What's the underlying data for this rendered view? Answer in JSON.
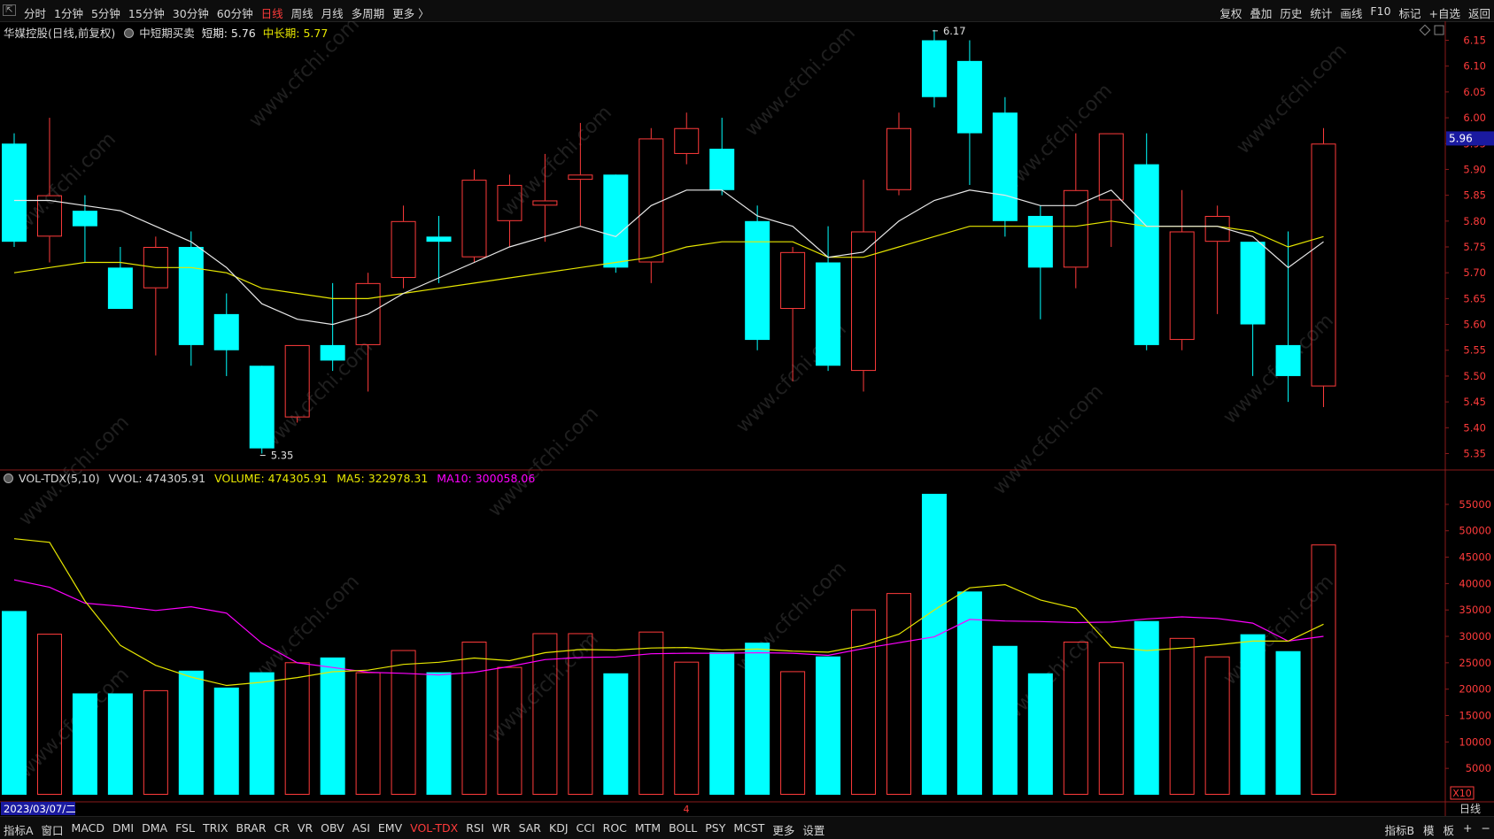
{
  "toolbar": {
    "left_items": [
      "分时",
      "1分钟",
      "5分钟",
      "15分钟",
      "30分钟",
      "60分钟",
      "日线",
      "周线",
      "月线",
      "多周期",
      "更多 〉"
    ],
    "active_item": "日线",
    "right_items": [
      "复权",
      "叠加",
      "历史",
      "统计",
      "画线",
      "F10",
      "标记",
      "+自选",
      "返回"
    ]
  },
  "main_info": {
    "stock": "华媒控股(日线,前复权)",
    "indicator": "中短期买卖",
    "short_label": "短期:",
    "short_value": "5.76",
    "mid_label": "中长期:",
    "mid_value": "5.77"
  },
  "vol_info": {
    "name": "VOL-TDX(5,10)",
    "vvol": "VVOL: 474305.91",
    "volume": "VOLUME: 474305.91",
    "ma5": "MA5: 322978.31",
    "ma10": "MA10: 300058.06"
  },
  "date_label": "2023/03/07/二",
  "x10_label": "X10",
  "period_label": "日线",
  "cursor_marker": "4",
  "bottom_tabs": [
    "指标A",
    "窗口",
    "MACD",
    "DMI",
    "DMA",
    "FSL",
    "TRIX",
    "BRAR",
    "CR",
    "VR",
    "OBV",
    "ASI",
    "EMV",
    "VOL-TDX",
    "RSI",
    "WR",
    "SAR",
    "KDJ",
    "CCI",
    "ROC",
    "MTM",
    "BOLL",
    "PSY",
    "MCST",
    "更多",
    "设置"
  ],
  "bottom_active": "VOL-TDX",
  "bottom_right": [
    "指标B",
    "模",
    "板",
    "+",
    "−"
  ],
  "watermark": "www.cfchi.com",
  "colors": {
    "up": "#ff3b3b",
    "down": "#00ffff",
    "ma_short": "#e8e8e8",
    "ma_long": "#e6e600",
    "vol_ma5": "#e6e600",
    "vol_ma10": "#ff00ff",
    "price_box": "#1a1aa0"
  },
  "chart_data": {
    "type": "candlestick",
    "price_axis": {
      "min": 5.32,
      "max": 6.18,
      "ticks": [
        "6.15",
        "6.10",
        "6.05",
        "6.00",
        "5.95",
        "5.90",
        "5.85",
        "5.80",
        "5.75",
        "5.70",
        "5.65",
        "5.60",
        "5.55",
        "5.50",
        "5.45",
        "5.40",
        "5.35"
      ]
    },
    "current_price": "5.96",
    "high_label": "6.17",
    "low_label": "5.35",
    "volume_axis": {
      "max": 58000,
      "ticks": [
        "55000",
        "50000",
        "45000",
        "40000",
        "35000",
        "30000",
        "25000",
        "20000",
        "15000",
        "10000",
        "5000"
      ]
    },
    "candles": [
      {
        "o": 5.95,
        "c": 5.76,
        "h": 5.97,
        "l": 5.75
      },
      {
        "o": 5.77,
        "c": 5.85,
        "h": 6.0,
        "l": 5.72
      },
      {
        "o": 5.82,
        "c": 5.79,
        "h": 5.85,
        "l": 5.72
      },
      {
        "o": 5.71,
        "c": 5.63,
        "h": 5.75,
        "l": 5.63
      },
      {
        "o": 5.67,
        "c": 5.75,
        "h": 5.77,
        "l": 5.54
      },
      {
        "o": 5.75,
        "c": 5.56,
        "h": 5.78,
        "l": 5.52
      },
      {
        "o": 5.62,
        "c": 5.55,
        "h": 5.66,
        "l": 5.5
      },
      {
        "o": 5.52,
        "c": 5.36,
        "h": 5.52,
        "l": 5.35
      },
      {
        "o": 5.42,
        "c": 5.56,
        "h": 5.56,
        "l": 5.41
      },
      {
        "o": 5.56,
        "c": 5.53,
        "h": 5.68,
        "l": 5.51
      },
      {
        "o": 5.56,
        "c": 5.68,
        "h": 5.7,
        "l": 5.47
      },
      {
        "o": 5.69,
        "c": 5.8,
        "h": 5.83,
        "l": 5.67
      },
      {
        "o": 5.77,
        "c": 5.76,
        "h": 5.81,
        "l": 5.68
      },
      {
        "o": 5.73,
        "c": 5.88,
        "h": 5.9,
        "l": 5.72
      },
      {
        "o": 5.8,
        "c": 5.87,
        "h": 5.89,
        "l": 5.75
      },
      {
        "o": 5.83,
        "c": 5.84,
        "h": 5.93,
        "l": 5.76
      },
      {
        "o": 5.88,
        "c": 5.89,
        "h": 5.99,
        "l": 5.79
      },
      {
        "o": 5.89,
        "c": 5.71,
        "h": 5.89,
        "l": 5.7
      },
      {
        "o": 5.72,
        "c": 5.96,
        "h": 5.98,
        "l": 5.68
      },
      {
        "o": 5.93,
        "c": 5.98,
        "h": 6.01,
        "l": 5.91
      },
      {
        "o": 5.94,
        "c": 5.86,
        "h": 6.0,
        "l": 5.85
      },
      {
        "o": 5.8,
        "c": 5.57,
        "h": 5.83,
        "l": 5.55
      },
      {
        "o": 5.63,
        "c": 5.74,
        "h": 5.75,
        "l": 5.49
      },
      {
        "o": 5.72,
        "c": 5.52,
        "h": 5.79,
        "l": 5.51
      },
      {
        "o": 5.51,
        "c": 5.78,
        "h": 5.88,
        "l": 5.47
      },
      {
        "o": 5.86,
        "c": 5.98,
        "h": 6.01,
        "l": 5.85
      },
      {
        "o": 6.15,
        "c": 6.04,
        "h": 6.17,
        "l": 6.02
      },
      {
        "o": 6.11,
        "c": 5.97,
        "h": 6.15,
        "l": 5.87
      },
      {
        "o": 6.01,
        "c": 5.8,
        "h": 6.04,
        "l": 5.77
      },
      {
        "o": 5.81,
        "c": 5.71,
        "h": 5.83,
        "l": 5.61
      },
      {
        "o": 5.71,
        "c": 5.86,
        "h": 5.97,
        "l": 5.67
      },
      {
        "o": 5.84,
        "c": 5.97,
        "h": 5.97,
        "l": 5.75
      },
      {
        "o": 5.91,
        "c": 5.56,
        "h": 5.97,
        "l": 5.55
      },
      {
        "o": 5.57,
        "c": 5.78,
        "h": 5.86,
        "l": 5.55
      },
      {
        "o": 5.76,
        "c": 5.81,
        "h": 5.83,
        "l": 5.62
      },
      {
        "o": 5.76,
        "c": 5.6,
        "h": 5.76,
        "l": 5.5
      },
      {
        "o": 5.56,
        "c": 5.5,
        "h": 5.78,
        "l": 5.45
      },
      {
        "o": 5.48,
        "c": 5.95,
        "h": 5.98,
        "l": 5.44
      }
    ],
    "ma_short": [
      5.84,
      5.84,
      5.83,
      5.82,
      5.79,
      5.76,
      5.71,
      5.64,
      5.61,
      5.6,
      5.62,
      5.66,
      5.69,
      5.72,
      5.75,
      5.77,
      5.79,
      5.77,
      5.83,
      5.86,
      5.86,
      5.81,
      5.79,
      5.73,
      5.74,
      5.8,
      5.84,
      5.86,
      5.85,
      5.83,
      5.83,
      5.86,
      5.79,
      5.79,
      5.79,
      5.77,
      5.71,
      5.76
    ],
    "ma_long": [
      5.7,
      5.71,
      5.72,
      5.72,
      5.71,
      5.71,
      5.7,
      5.67,
      5.66,
      5.65,
      5.65,
      5.66,
      5.67,
      5.68,
      5.69,
      5.7,
      5.71,
      5.72,
      5.73,
      5.75,
      5.76,
      5.76,
      5.76,
      5.73,
      5.73,
      5.75,
      5.77,
      5.79,
      5.79,
      5.79,
      5.79,
      5.8,
      5.79,
      5.79,
      5.79,
      5.78,
      5.75,
      5.77
    ],
    "volume": [
      34800,
      30500,
      19200,
      19200,
      19800,
      23500,
      20300,
      23200,
      25100,
      26000,
      23200,
      27400,
      23200,
      29000,
      24200,
      30600,
      30600,
      23000,
      30900,
      25200,
      27000,
      28800,
      23400,
      26200,
      35100,
      38200,
      57000,
      38500,
      28200,
      23000,
      29000,
      25100,
      32900,
      29700,
      26200,
      30400,
      27200,
      47400
    ],
    "vol_ma5": [
      48500,
      47800,
      36700,
      28300,
      24500,
      22300,
      20700,
      21300,
      22200,
      23300,
      23600,
      24700,
      25100,
      25900,
      25400,
      26900,
      27500,
      27400,
      27800,
      27900,
      27400,
      27600,
      27200,
      27000,
      28300,
      30400,
      35000,
      39200,
      39800,
      36900,
      35300,
      28000,
      27300,
      27800,
      28400,
      29100,
      29100,
      32300
    ],
    "vol_ma10": [
      40700,
      39300,
      36300,
      35700,
      34900,
      35600,
      34400,
      28700,
      25000,
      24100,
      23200,
      23000,
      22700,
      23200,
      24300,
      25600,
      26000,
      26100,
      26700,
      26800,
      26800,
      26900,
      26800,
      26400,
      27700,
      28800,
      29900,
      33200,
      32900,
      32800,
      32600,
      32700,
      33300,
      33700,
      33400,
      32500,
      29100,
      30000
    ]
  }
}
